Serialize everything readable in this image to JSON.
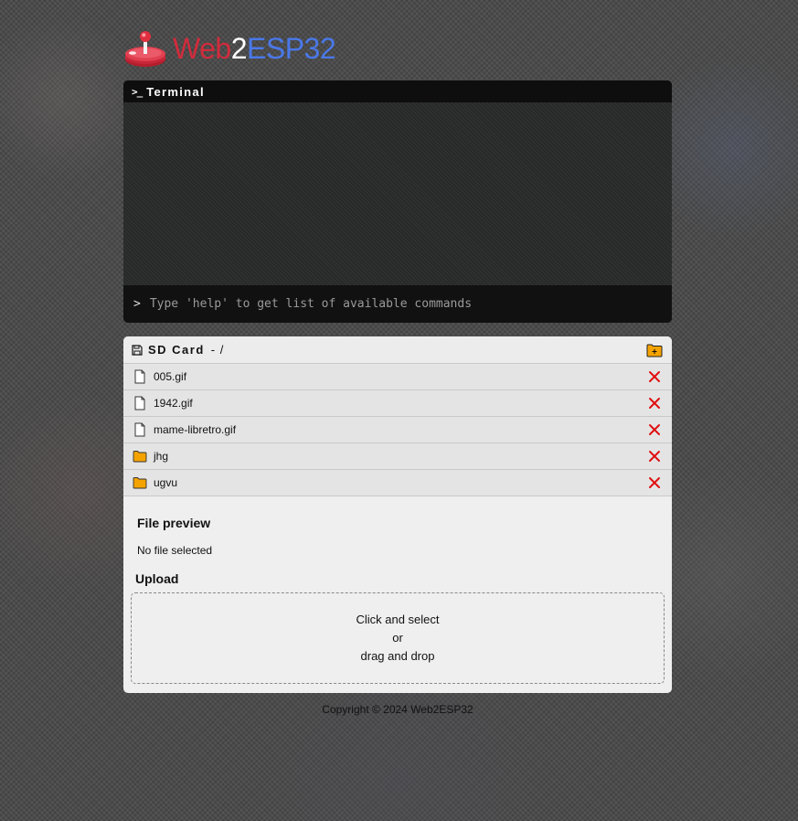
{
  "brand": {
    "part1": "Web",
    "part2": "2",
    "part3": "ESP32",
    "colors": {
      "web": "#d12b3c",
      "two": "#ffffff",
      "esp": "#4a78e8"
    }
  },
  "terminal": {
    "title": "Terminal",
    "prompt_symbol": ">",
    "input_placeholder": "Type 'help' to get list of available commands",
    "input_value": ""
  },
  "sdcard": {
    "title": "SD Card",
    "path": "- /",
    "new_folder_icon": "folder-plus-icon",
    "items": [
      {
        "name": "005.gif",
        "type": "file"
      },
      {
        "name": "1942.gif",
        "type": "file"
      },
      {
        "name": "mame-libretro.gif",
        "type": "file"
      },
      {
        "name": "jhg",
        "type": "folder"
      },
      {
        "name": "ugvu",
        "type": "folder"
      }
    ],
    "accent": {
      "folder": "#f5a300",
      "delete": "#e01010"
    }
  },
  "preview": {
    "title": "File preview",
    "text": "No file selected"
  },
  "upload": {
    "title": "Upload",
    "line1": "Click and select",
    "line2": "or",
    "line3": "drag and drop"
  },
  "footer": {
    "text": "Copyright © 2024 Web2ESP32"
  }
}
